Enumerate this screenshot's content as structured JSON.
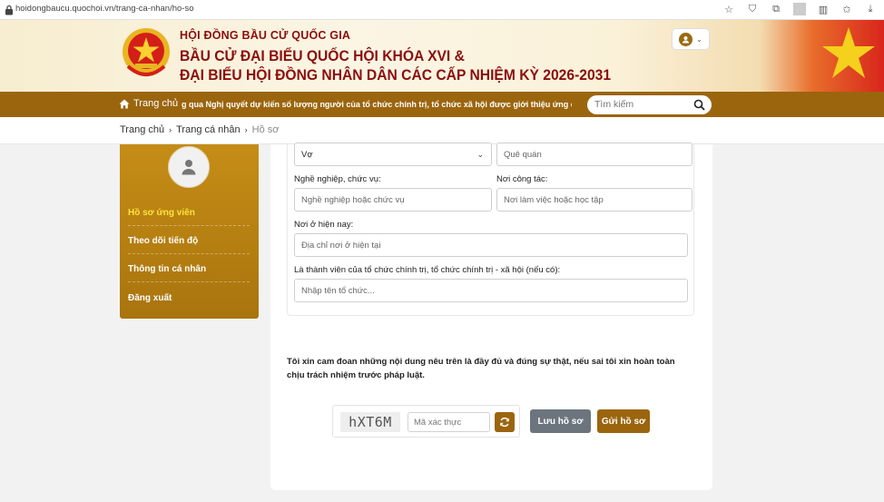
{
  "browser": {
    "url": "hoidongbaucu.quochoi.vn/trang-ca-nhan/ho-so"
  },
  "header": {
    "org": "HỘI ĐỒNG BẦU CỬ QUỐC GIA",
    "title_line1": "BẦU CỬ ĐẠI BIỂU QUỐC HỘI KHÓA XVI &",
    "title_line2": "ĐẠI BIỂU HỘI ĐỒNG NHÂN DÂN CÁC CẤP NHIỆM KỲ 2026-2031"
  },
  "nav": {
    "home_label": "Trang chủ",
    "ticker": "g qua Nghị quyết dự kiến số lượng người của tổ chức chính trị, tổ chức xã hội được giới thiệu ứng cử ĐBQH Khóa XVI",
    "search_placeholder": "Tìm kiếm"
  },
  "breadcrumb": {
    "items": [
      "Trang chủ",
      "Trang cá nhân",
      "Hồ sơ"
    ]
  },
  "sidebar": {
    "items": [
      {
        "label": "Hồ sơ ứng viên",
        "active": true
      },
      {
        "label": "Theo dõi tiến độ",
        "active": false
      },
      {
        "label": "Thông tin cá nhân",
        "active": false
      },
      {
        "label": "Đăng xuất",
        "active": false
      }
    ]
  },
  "form": {
    "relation_value": "Vợ",
    "hometown_placeholder": "Quê quán",
    "occupation_label": "Nghề nghiệp, chức vụ:",
    "occupation_placeholder": "Nghề nghiệp hoặc chức vụ",
    "workplace_label": "Nơi công tác:",
    "workplace_placeholder": "Nơi làm việc hoặc học tập",
    "residence_label": "Nơi ở hiện nay:",
    "residence_placeholder": "Địa chỉ nơi ở hiện tại",
    "member_label": "Là thành viên của tổ chức chính trị, tổ chức chính trị - xã hội (nếu có):",
    "member_placeholder": "Nhập tên tổ chức..."
  },
  "declaration": "Tôi xin cam đoan những nội dung nêu trên là đầy đủ và đúng sự thật, nếu sai tôi xin hoàn toàn chịu trách nhiệm trước pháp luật.",
  "captcha": {
    "code": "hXT6M",
    "placeholder": "Mã xác thực"
  },
  "buttons": {
    "save": "Lưu hồ sơ",
    "send": "Gửi hồ sơ"
  },
  "colors": {
    "brand_gold": "#9b650e",
    "title_red": "#8b0e0e",
    "active_yellow": "#ffe23a"
  }
}
